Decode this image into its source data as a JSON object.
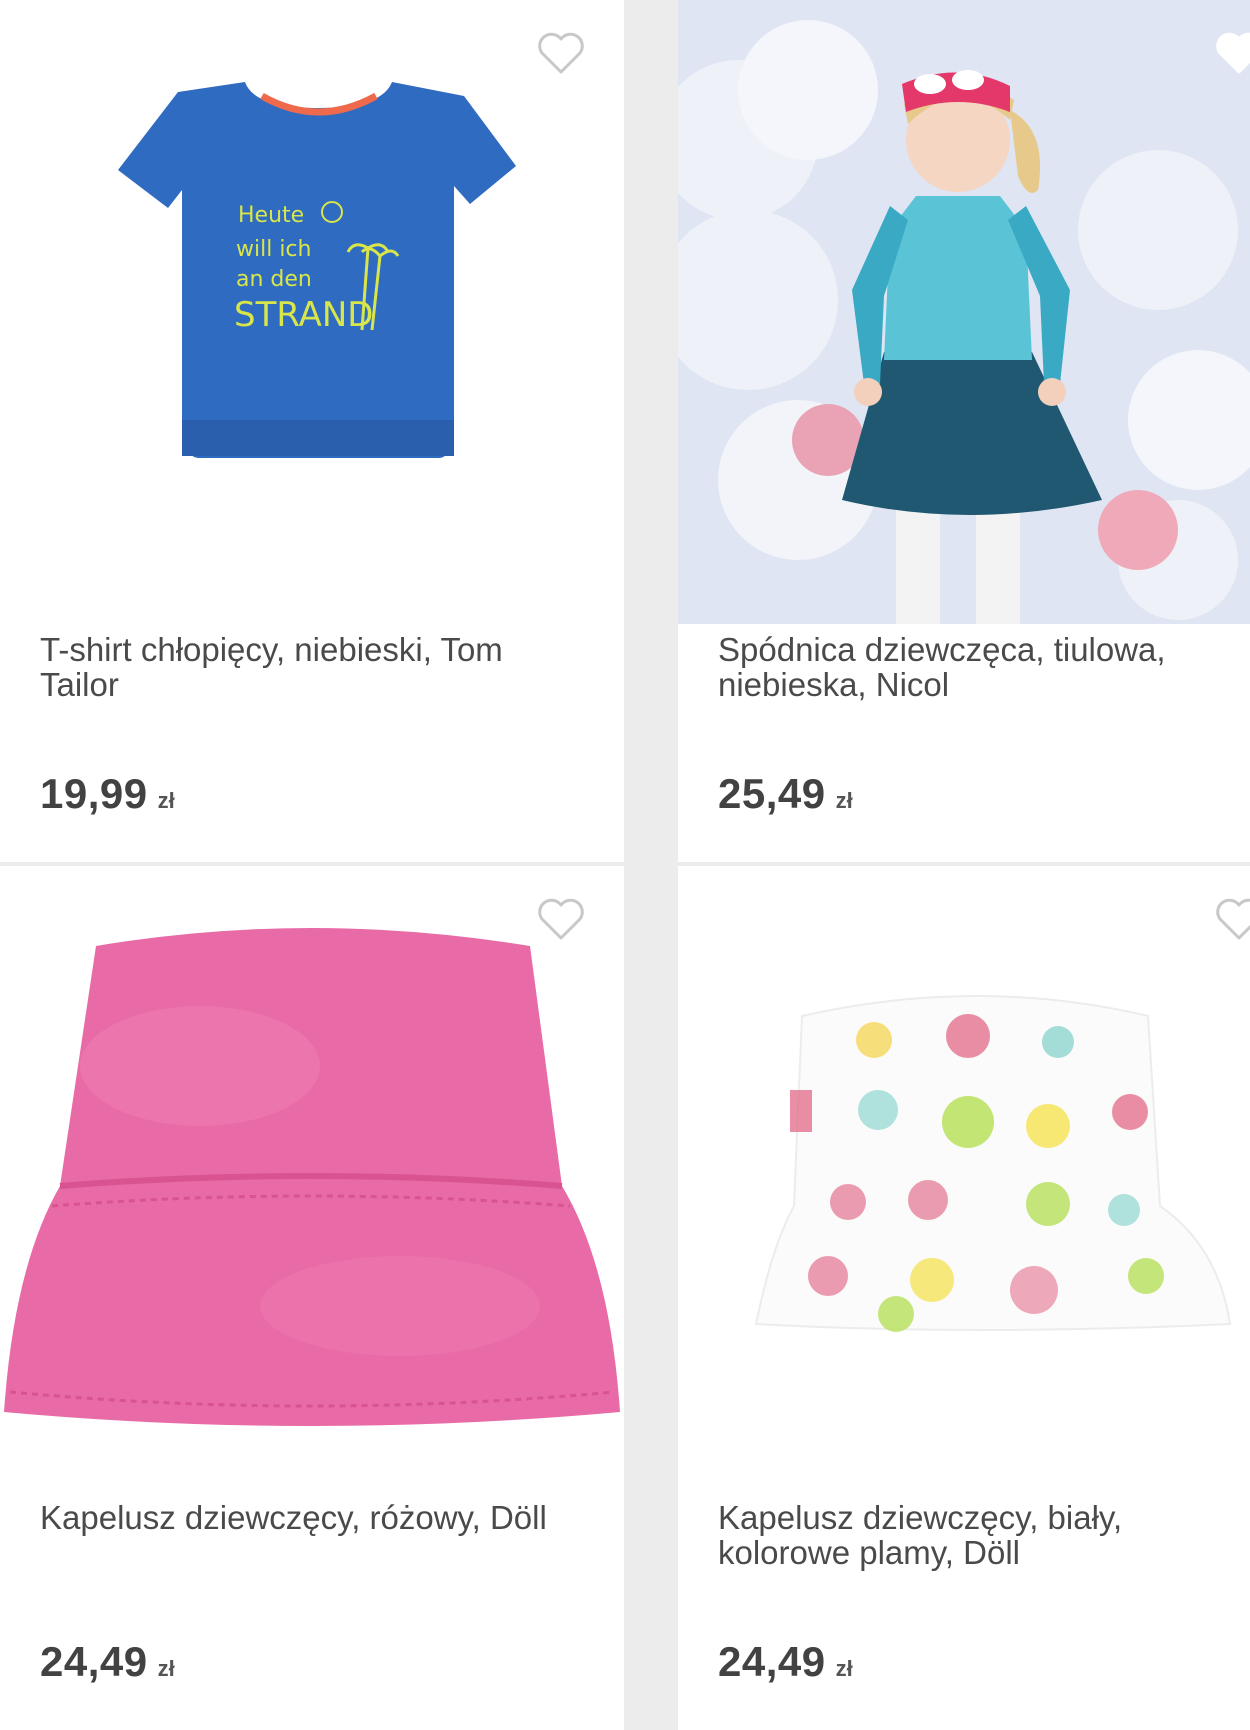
{
  "products": [
    {
      "title": "T-shirt chłopięcy, niebieski, Tom Tailor",
      "price": "19,99",
      "currency": "zł",
      "shirt_print": [
        "Heute",
        "will ich",
        "an den",
        "STRAND"
      ],
      "image_icon": "blue-tshirt-image",
      "favorite_icon": "heart-outline-icon"
    },
    {
      "title": "Spódnica dziewczęca, tiulowa, niebieska, Nicol",
      "price": "25,49",
      "currency": "zł",
      "image_icon": "girl-in-tulle-skirt-photo",
      "favorite_icon": "heart-filled-icon"
    },
    {
      "title": "Kapelusz dziewczęcy, różowy, Döll",
      "price": "24,49",
      "currency": "zł",
      "image_icon": "pink-bucket-hat-image",
      "favorite_icon": "heart-outline-icon"
    },
    {
      "title": "Kapelusz dziewczęcy, biały, kolorowe plamy, Döll",
      "price": "24,49",
      "currency": "zł",
      "image_icon": "white-spotted-bucket-hat-image",
      "favorite_icon": "heart-outline-icon"
    }
  ],
  "colors": {
    "background": "#ececec",
    "card": "#ffffff",
    "text": "#424242",
    "heart_outline": "#c8c8c8",
    "shirt_blue": "#2f6bc0",
    "hat_pink": "#e86aa6"
  }
}
